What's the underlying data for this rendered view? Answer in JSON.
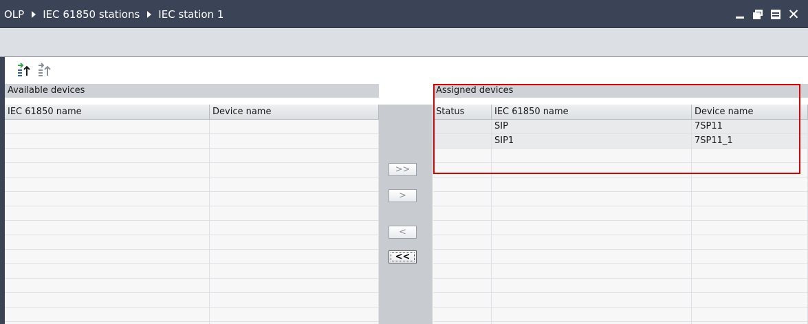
{
  "window": {
    "breadcrumbs": [
      "OLP",
      "IEC 61850 stations",
      "IEC station 1"
    ]
  },
  "toolbar": {
    "icons": [
      "assign-device-icon",
      "unassign-device-icon"
    ]
  },
  "available": {
    "title": "Available devices",
    "columns": [
      "IEC 61850 name",
      "Device name"
    ],
    "rows": []
  },
  "assigned": {
    "title": "Assigned devices",
    "columns": [
      "Status",
      "IEC 61850 name",
      "Device name"
    ],
    "rows": [
      {
        "status": "",
        "iec_name": "SIP",
        "device_name": "7SP11"
      },
      {
        "status": "",
        "iec_name": "SIP1",
        "device_name": "7SP11_1"
      }
    ]
  },
  "transfer_buttons": {
    "assign_all": ">>",
    "assign": ">",
    "unassign": "<",
    "unassign_all": "<<"
  }
}
